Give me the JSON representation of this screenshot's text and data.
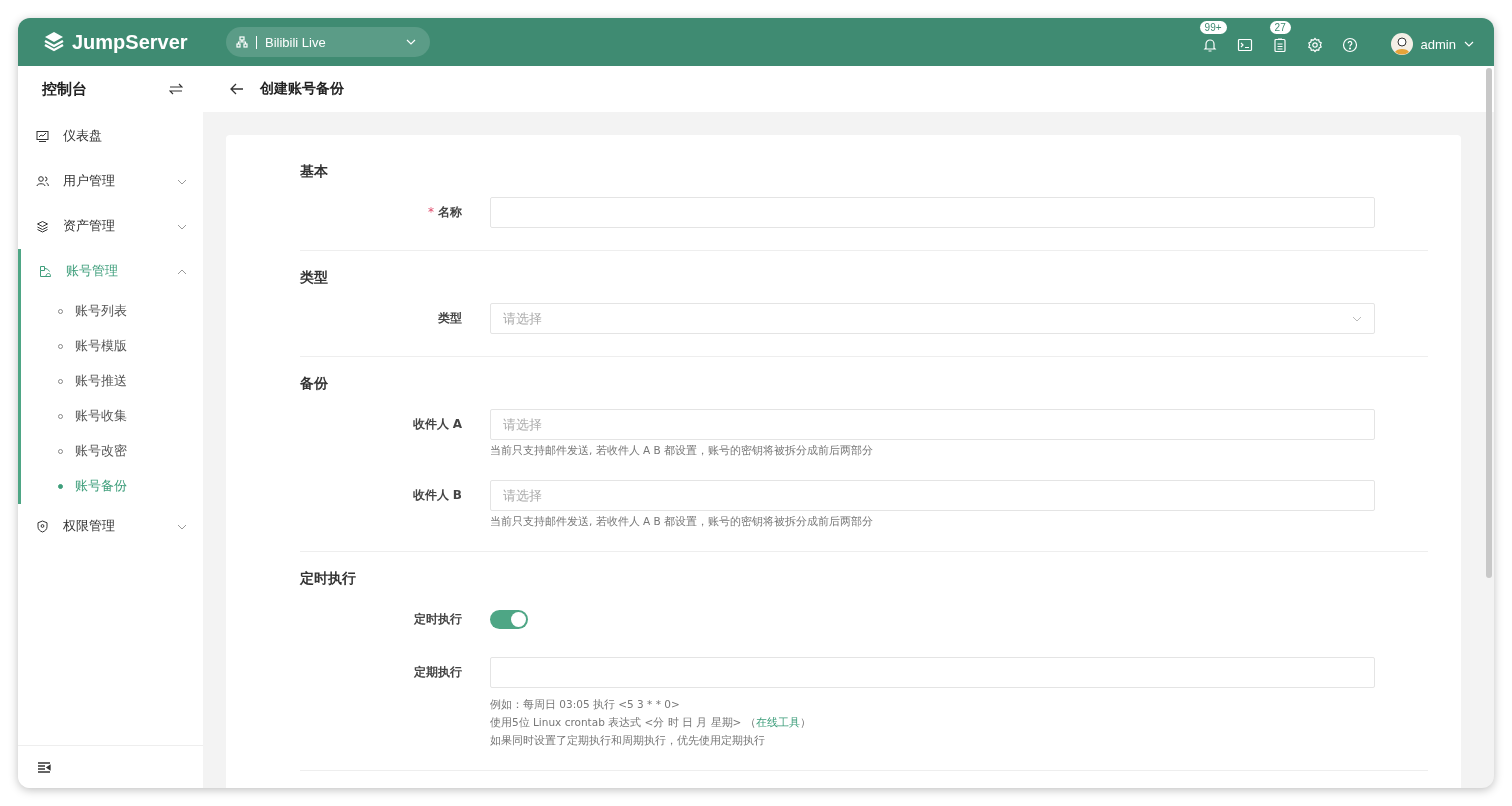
{
  "header": {
    "logo": "JumpServer",
    "org": {
      "label": "Bilibili Live"
    },
    "tools": [
      {
        "kind": "bell",
        "badge": "99+"
      },
      {
        "kind": "terminal"
      },
      {
        "kind": "tasks",
        "badge": "27"
      },
      {
        "kind": "settings"
      },
      {
        "kind": "help"
      }
    ],
    "user": "admin"
  },
  "sidebar": {
    "title": "控制台",
    "items": [
      {
        "kind": "link",
        "label": "仪表盘",
        "selected": false
      },
      {
        "kind": "group",
        "label": "用户管理",
        "selected": false,
        "expanded": false
      },
      {
        "kind": "group",
        "label": "资产管理",
        "selected": false,
        "expanded": false
      },
      {
        "kind": "group",
        "label": "账号管理",
        "selected": true,
        "expanded": true,
        "children": [
          {
            "label": "账号列表",
            "selected": false
          },
          {
            "label": "账号模版",
            "selected": false
          },
          {
            "label": "账号推送",
            "selected": false
          },
          {
            "label": "账号收集",
            "selected": false
          },
          {
            "label": "账号改密",
            "selected": false
          },
          {
            "label": "账号备份",
            "selected": true
          }
        ]
      },
      {
        "kind": "group",
        "label": "权限管理",
        "selected": false,
        "expanded": false
      }
    ]
  },
  "page": {
    "title": "创建账号备份"
  },
  "form": {
    "sections": [
      {
        "title": "基本",
        "fields": [
          {
            "kind": "input",
            "label": "名称",
            "required_mark": "*"
          }
        ]
      },
      {
        "title": "类型",
        "fields": [
          {
            "kind": "select",
            "label": "类型",
            "placeholder": "请选择"
          }
        ]
      },
      {
        "title": "备份",
        "fields": [
          {
            "kind": "multiselect",
            "label": "收件人 A",
            "placeholder": "请选择",
            "hints": [
              {
                "text": "当前只支持邮件发送, 若收件人 A B 都设置，账号的密钥将被拆分成前后两部分"
              }
            ]
          },
          {
            "kind": "multiselect",
            "label": "收件人 B",
            "placeholder": "请选择",
            "hints": [
              {
                "text": "当前只支持邮件发送, 若收件人 A B 都设置，账号的密钥将被拆分成前后两部分"
              }
            ]
          }
        ]
      },
      {
        "title": "定时执行",
        "fields": [
          {
            "kind": "switch",
            "label": "定时执行",
            "on": true
          },
          {
            "kind": "input",
            "label": "定期执行",
            "hints": [
              {
                "text": "例如：每周日 03:05 执行 <5 3 * * 0>"
              },
              {
                "text": "使用5位 Linux crontab 表达式 <分 时 日 月 星期> （",
                "link": "在线工具",
                "after": "）"
              },
              {
                "text": "如果同时设置了定期执行和周期执行，优先使用定期执行"
              }
            ]
          }
        ]
      }
    ]
  }
}
